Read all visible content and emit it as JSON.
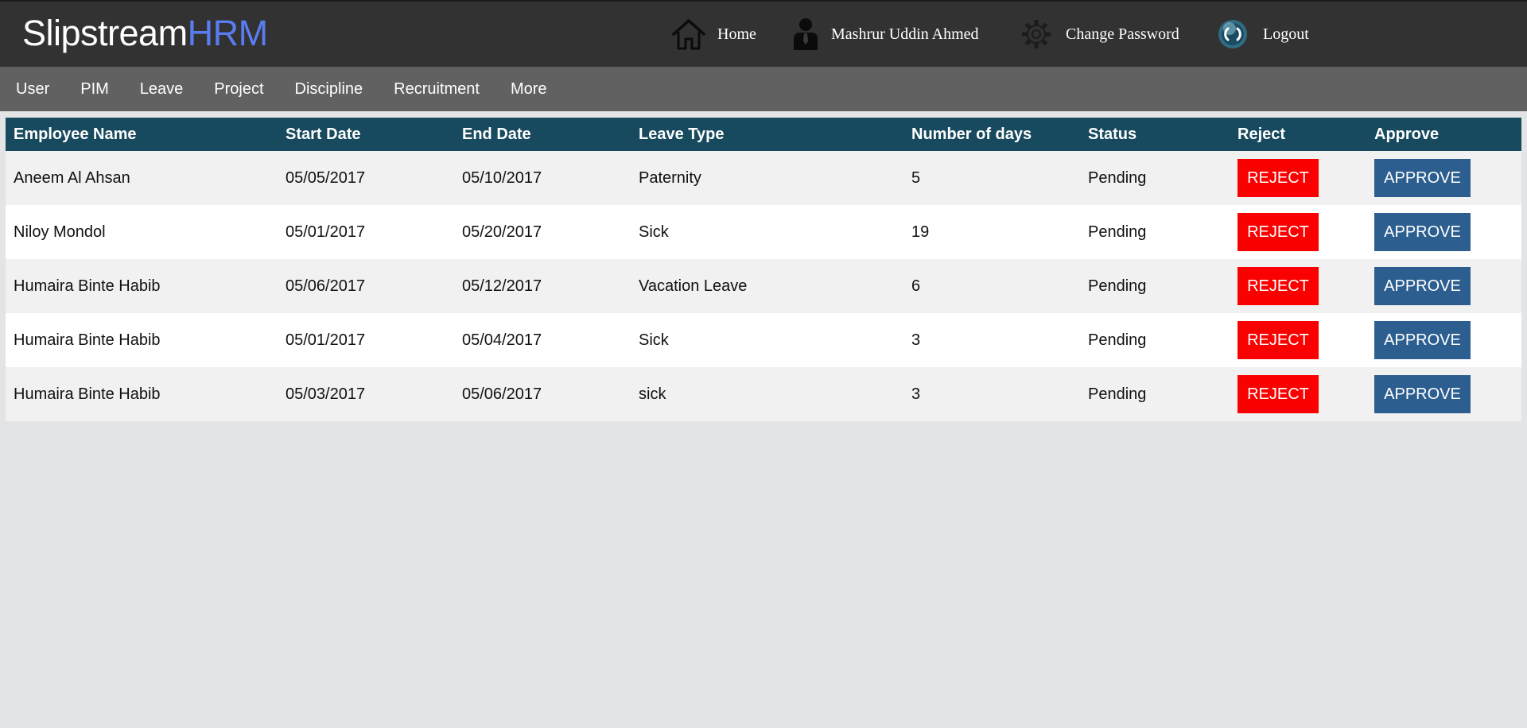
{
  "header": {
    "logo_part1": "Slipstream",
    "logo_part2": "HRM",
    "nav": {
      "home": "Home",
      "user": "Mashrur Uddin Ahmed",
      "change_password": "Change Password",
      "logout": "Logout"
    }
  },
  "menu": [
    "User",
    "PIM",
    "Leave",
    "Project",
    "Discipline",
    "Recruitment",
    "More"
  ],
  "table": {
    "columns": [
      "Employee Name",
      "Start Date",
      "End Date",
      "Leave Type",
      "Number of days",
      "Status",
      "Reject",
      "Approve"
    ],
    "rows": [
      {
        "name": "Aneem Al Ahsan",
        "start": "05/05/2017",
        "end": "05/10/2017",
        "type": "Paternity",
        "days": "5",
        "status": "Pending",
        "reject": "REJECT",
        "approve": "APPROVE"
      },
      {
        "name": "Niloy Mondol",
        "start": "05/01/2017",
        "end": "05/20/2017",
        "type": "Sick",
        "days": "19",
        "status": "Pending",
        "reject": "REJECT",
        "approve": "APPROVE"
      },
      {
        "name": "Humaira Binte Habib",
        "start": "05/06/2017",
        "end": "05/12/2017",
        "type": "Vacation Leave",
        "days": "6",
        "status": "Pending",
        "reject": "REJECT",
        "approve": "APPROVE"
      },
      {
        "name": "Humaira Binte Habib",
        "start": "05/01/2017",
        "end": "05/04/2017",
        "type": "Sick",
        "days": "3",
        "status": "Pending",
        "reject": "REJECT",
        "approve": "APPROVE"
      },
      {
        "name": "Humaira Binte Habib",
        "start": "05/03/2017",
        "end": "05/06/2017",
        "type": "sick",
        "days": "3",
        "status": "Pending",
        "reject": "REJECT",
        "approve": "APPROVE"
      }
    ]
  },
  "colors": {
    "topbar": "#323232",
    "menubar": "#616161",
    "table_header": "#174a5e",
    "logo_accent": "#5a7cf2",
    "reject": "#fa0000",
    "approve": "#2c5f8f",
    "background": "#e3e4e6"
  },
  "icons": {
    "home": "home-icon",
    "user": "user-icon",
    "change_password": "gear-icon",
    "logout": "logout-icon"
  }
}
